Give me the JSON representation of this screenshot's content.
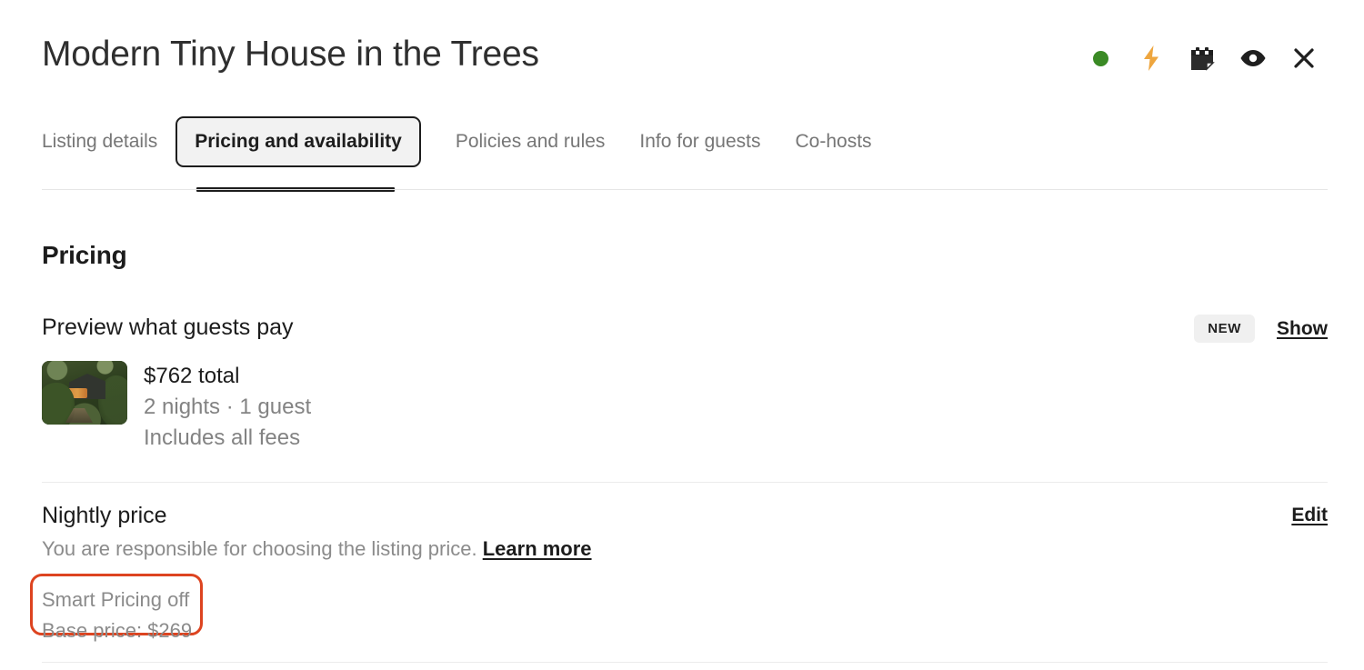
{
  "header": {
    "title": "Modern Tiny House in the Trees",
    "icons": [
      {
        "name": "status-dot-icon",
        "label": "status",
        "color": "#3a8a25"
      },
      {
        "name": "instant-book-bolt-icon",
        "label": "instant book",
        "color": "#eea63f"
      },
      {
        "name": "calendar-icon",
        "label": "calendar",
        "color": "#222222"
      },
      {
        "name": "preview-eye-icon",
        "label": "preview",
        "color": "#222222"
      },
      {
        "name": "close-icon",
        "label": "close",
        "color": "#222222"
      }
    ]
  },
  "tabs": {
    "items": [
      {
        "label": "Listing details",
        "active": false
      },
      {
        "label": "Pricing and availability",
        "active": true
      },
      {
        "label": "Policies and rules",
        "active": false
      },
      {
        "label": "Info for guests",
        "active": false
      },
      {
        "label": "Co-hosts",
        "active": false
      }
    ]
  },
  "main": {
    "section_title": "Pricing",
    "preview": {
      "heading": "Preview what guests pay",
      "badge": "NEW",
      "show_link": "Show",
      "price_total": "$762 total",
      "stay_details": "2 nights · 1 guest",
      "fees_note": "Includes all fees"
    },
    "nightly_price": {
      "heading": "Nightly price",
      "description": "You are responsible for choosing the listing price.",
      "learn_more": "Learn more",
      "edit_link": "Edit",
      "smart_pricing_status": "Smart Pricing off",
      "base_price": "Base price: $269",
      "highlight_color": "#dd4420"
    }
  }
}
